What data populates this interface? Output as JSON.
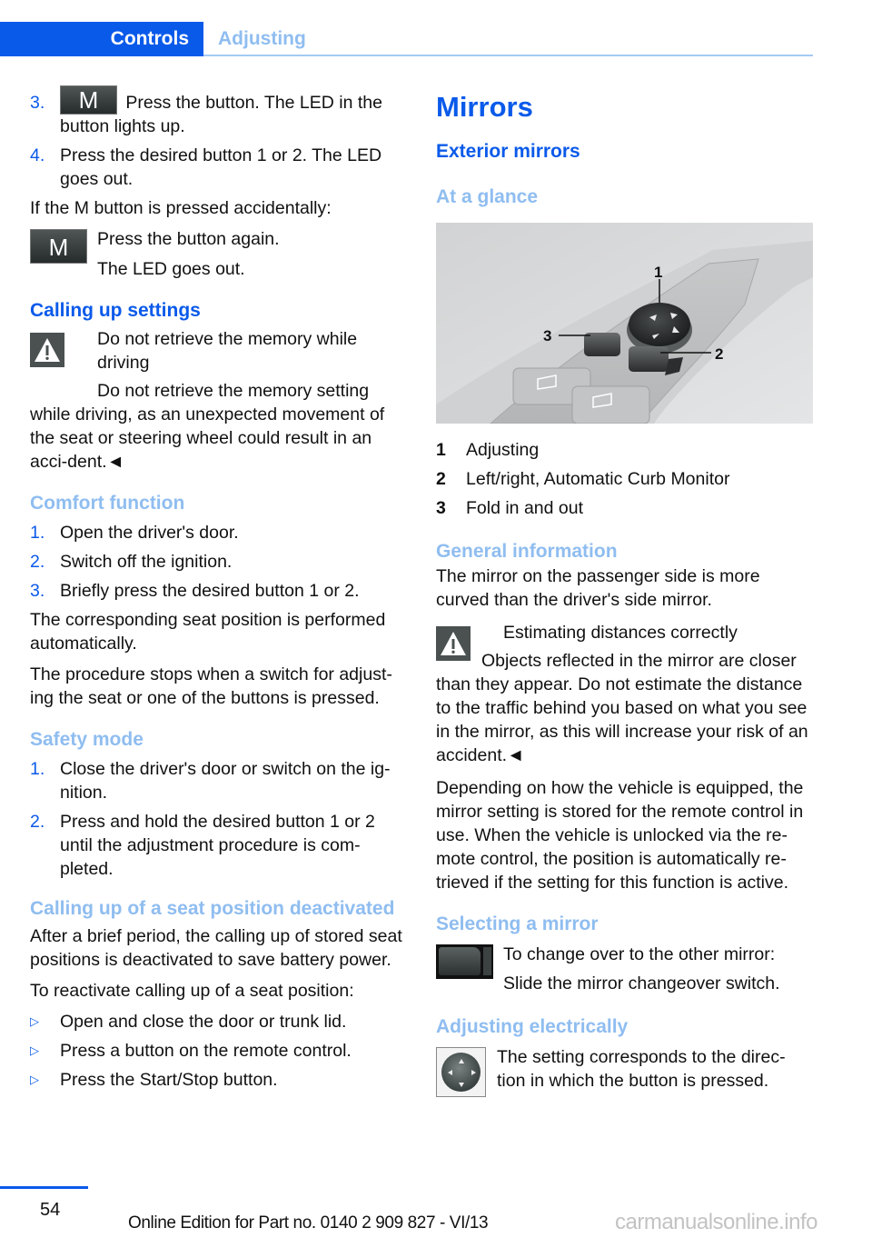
{
  "header": {
    "tabs": [
      {
        "label": "Controls",
        "active": true
      },
      {
        "label": "Adjusting",
        "active": false
      }
    ],
    "accent_color": "#0a5aea",
    "light_color": "#8fbdf0"
  },
  "left": {
    "steps_top": [
      {
        "num": "3.",
        "icon": "M",
        "text": "Press the button. The LED in the button lights up."
      },
      {
        "num": "4.",
        "text": "Press the desired button 1 or 2. The LED goes out."
      }
    ],
    "accidental_intro": "If the M button is pressed accidentally:",
    "accidental_icon": "M",
    "accidental_lines": [
      "Press the button again.",
      "The LED goes out."
    ],
    "calling_up": {
      "heading": "Calling up settings",
      "warning_title": "Do not retrieve the memory while driving",
      "warning_text": "Do not retrieve the memory setting while driving, as an unexpected movement of the seat or steering wheel could result in an acci-dent.◄"
    },
    "comfort": {
      "heading": "Comfort function",
      "steps": [
        {
          "num": "1.",
          "text": "Open the driver's door."
        },
        {
          "num": "2.",
          "text": "Switch off the ignition."
        },
        {
          "num": "3.",
          "text": "Briefly press the desired button 1 or 2."
        }
      ],
      "para1": "The corresponding seat position is performed automatically.",
      "para2": "The procedure stops when a switch for adjust-ing the seat or one of the buttons is pressed."
    },
    "safety": {
      "heading": "Safety mode",
      "steps": [
        {
          "num": "1.",
          "text": "Close the driver's door or switch on the ig-nition."
        },
        {
          "num": "2.",
          "text": "Press and hold the desired button 1 or 2 until the adjustment procedure is com-pleted."
        }
      ]
    },
    "deactivated": {
      "heading": "Calling up of a seat position deactivated",
      "para": "After a brief period, the calling up of stored seat positions is deactivated to save battery power.",
      "intro": "To reactivate calling up of a seat position:",
      "bullet_glyph": "▷",
      "bullets": [
        "Open and close the door or trunk lid.",
        "Press a button on the remote control.",
        "Press the Start/Stop button."
      ]
    }
  },
  "right": {
    "title": "Mirrors",
    "subtitle": "Exterior mirrors",
    "glance_heading": "At a glance",
    "figure_callouts": [
      "1",
      "2",
      "3"
    ],
    "legend": [
      {
        "num": "1",
        "text": "Adjusting"
      },
      {
        "num": "2",
        "text": "Left/right, Automatic Curb Monitor"
      },
      {
        "num": "3",
        "text": "Fold in and out"
      }
    ],
    "general": {
      "heading": "General information",
      "para": "The mirror on the passenger side is more curved than the driver's side mirror.",
      "warning_title": "Estimating distances correctly",
      "warning_text": "Objects reflected in the mirror are closer than they appear. Do not estimate the distance to the traffic behind you based on what you see in the mirror, as this will increase your risk of an accident.◄",
      "para2": "Depending on how the vehicle is equipped, the mirror setting is stored for the remote control in use. When the vehicle is unlocked via the re-mote control, the position is automatically re-trieved if the setting for this function is active."
    },
    "selecting": {
      "heading": "Selecting a mirror",
      "lines": [
        "To change over to the other mirror:",
        "Slide the mirror changeover switch."
      ]
    },
    "adjusting": {
      "heading": "Adjusting electrically",
      "text": "The setting corresponds to the direc-tion in which the button is pressed."
    }
  },
  "footer": {
    "page_number": "54",
    "edition": "Online Edition for Part no. 0140 2 909 827 - VI/13",
    "watermark": "carmanualsonline.info"
  }
}
